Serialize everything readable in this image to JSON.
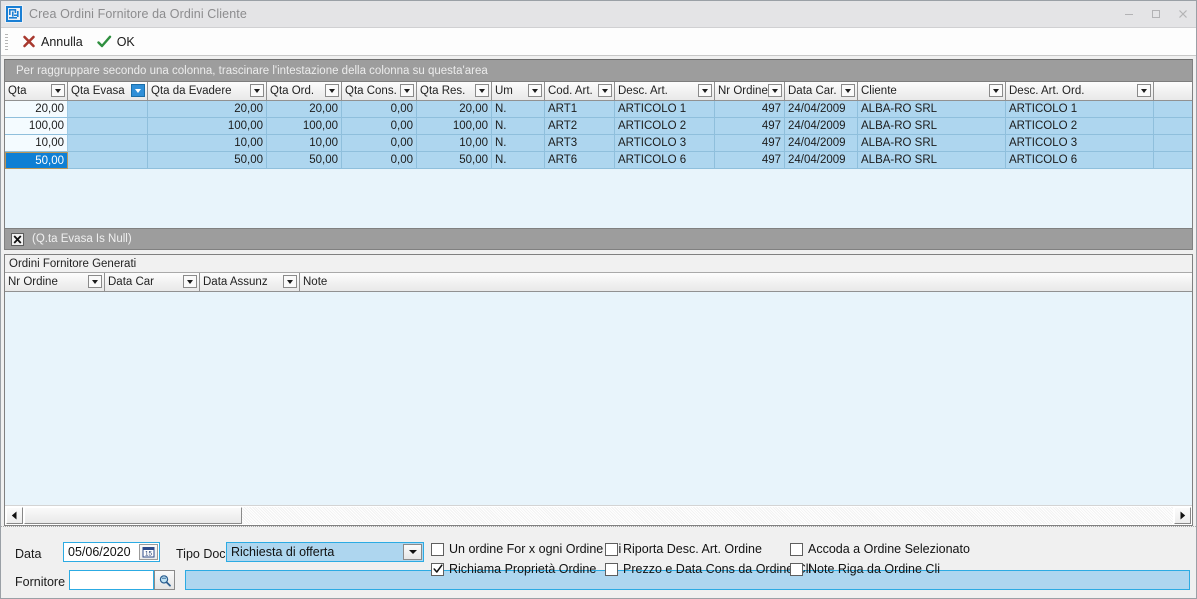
{
  "window": {
    "title": "Crea Ordini Fornitore da Ordini Cliente",
    "icon": "app-maze-icon",
    "minimize_label": "–",
    "maximize_label": "□",
    "close_label": "×"
  },
  "toolbar": {
    "cancel_label": "Annulla",
    "ok_label": "OK"
  },
  "top_grid": {
    "group_hint": "Per raggruppare secondo una colonna, trascinare l'intestazione della colonna su questa'area",
    "columns": [
      {
        "label": "Qta",
        "width": 63,
        "align": "right",
        "filter_active": false
      },
      {
        "label": "Qta Evasa",
        "width": 80,
        "align": "right",
        "filter_active": true
      },
      {
        "label": "Qta da Evadere",
        "width": 119,
        "align": "right",
        "filter_active": false
      },
      {
        "label": "Qta Ord.",
        "width": 75,
        "align": "right",
        "filter_active": false
      },
      {
        "label": "Qta Cons.",
        "width": 75,
        "align": "right",
        "filter_active": false
      },
      {
        "label": "Qta Res.",
        "width": 75,
        "align": "right",
        "filter_active": false
      },
      {
        "label": "Um",
        "width": 53,
        "align": "left",
        "filter_active": false
      },
      {
        "label": "Cod. Art.",
        "width": 70,
        "align": "left",
        "filter_active": false
      },
      {
        "label": "Desc. Art.",
        "width": 100,
        "align": "left",
        "filter_active": false
      },
      {
        "label": "Nr Ordine",
        "width": 70,
        "align": "right",
        "filter_active": false
      },
      {
        "label": "Data Car.",
        "width": 73,
        "align": "left",
        "filter_active": false
      },
      {
        "label": "Cliente",
        "width": 148,
        "align": "left",
        "filter_active": false
      },
      {
        "label": "Desc. Art. Ord.",
        "width": 148,
        "align": "left",
        "filter_active": false
      }
    ],
    "rows": [
      {
        "selected": false,
        "cells": [
          "20,00",
          "",
          "20,00",
          "20,00",
          "0,00",
          "20,00",
          "N.",
          "ART1",
          "ARTICOLO 1",
          "497",
          "24/04/2009",
          "ALBA-RO SRL",
          "ARTICOLO 1"
        ]
      },
      {
        "selected": false,
        "cells": [
          "100,00",
          "",
          "100,00",
          "100,00",
          "0,00",
          "100,00",
          "N.",
          "ART2",
          "ARTICOLO 2",
          "497",
          "24/04/2009",
          "ALBA-RO SRL",
          "ARTICOLO 2"
        ]
      },
      {
        "selected": false,
        "cells": [
          "10,00",
          "",
          "10,00",
          "10,00",
          "0,00",
          "10,00",
          "N.",
          "ART3",
          "ARTICOLO 3",
          "497",
          "24/04/2009",
          "ALBA-RO SRL",
          "ARTICOLO 3"
        ]
      },
      {
        "selected": true,
        "cells": [
          "50,00",
          "",
          "50,00",
          "50,00",
          "0,00",
          "50,00",
          "N.",
          "ART6",
          "ARTICOLO 6",
          "497",
          "24/04/2009",
          "ALBA-RO SRL",
          "ARTICOLO 6"
        ]
      }
    ]
  },
  "filter_bar": {
    "close_label": "✖",
    "expression": "(Q.ta Evasa Is Null)"
  },
  "bottom_grid": {
    "title": "Ordini Fornitore Generati",
    "columns": [
      {
        "label": "Nr Ordine",
        "width": 100,
        "has_filter": true
      },
      {
        "label": "Data Car",
        "width": 95,
        "has_filter": true
      },
      {
        "label": "Data Assunz",
        "width": 100,
        "has_filter": true
      },
      {
        "label": "Note",
        "width": 0,
        "has_filter": false
      }
    ],
    "rows": []
  },
  "form": {
    "data_label": "Data",
    "data_value": "05/06/2020",
    "data_calendar_icon": "calendar-icon",
    "tipo_doc_label": "Tipo Doc",
    "tipo_doc_value": "Richiesta di offerta",
    "tipo_doc_options": [
      "Richiesta di offerta"
    ],
    "fornitore_label": "Fornitore",
    "fornitore_value": "",
    "fornitore_search_icon": "search-icon",
    "fornitore_desc_value": "",
    "checkboxes": [
      {
        "label": "Un ordine For x ogni Ordine Cli",
        "checked": false,
        "col": 0,
        "row": 0
      },
      {
        "label": "Richiama Proprietà Ordine",
        "checked": true,
        "col": 0,
        "row": 1
      },
      {
        "label": "Riporta Desc. Art. Ordine",
        "checked": false,
        "col": 1,
        "row": 0
      },
      {
        "label": "Prezzo e Data Cons da Ordine Cli",
        "checked": false,
        "col": 1,
        "row": 1
      },
      {
        "label": "Accoda a Ordine Selezionato",
        "checked": false,
        "col": 2,
        "row": 0
      },
      {
        "label": "Note Riga da Ordine Cli",
        "checked": false,
        "col": 2,
        "row": 1
      }
    ]
  },
  "colors": {
    "accent_blue": "#2cabe3",
    "row_blue": "#aed6ef",
    "selection_blue": "#0f7fd4",
    "grid_bg": "#e8f4fb",
    "header_gray": "#9d9d9d"
  }
}
